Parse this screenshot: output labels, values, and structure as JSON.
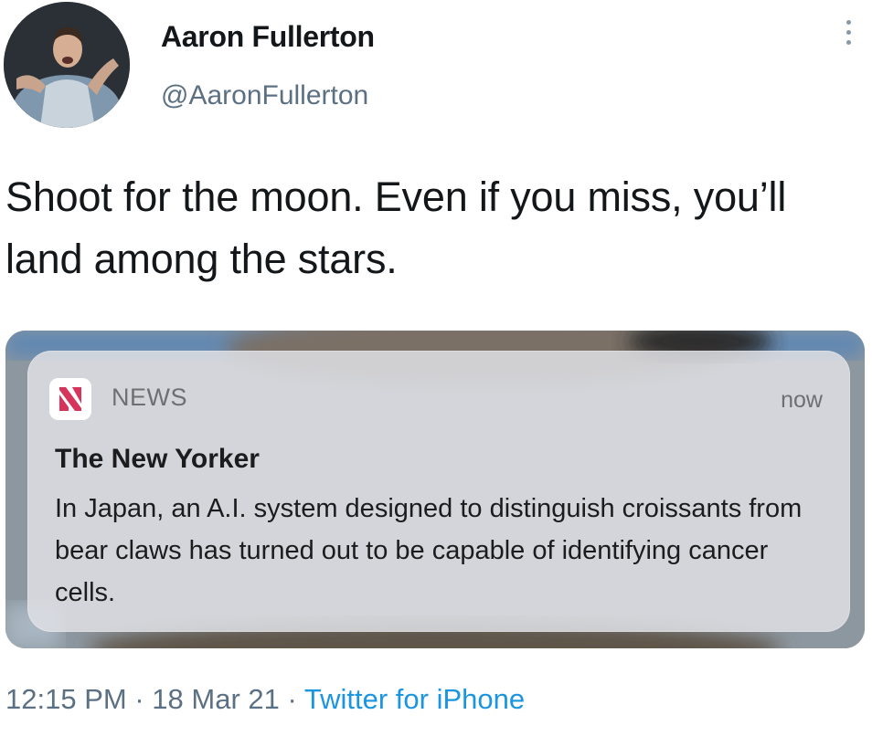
{
  "tweet": {
    "author": {
      "display_name": "Aaron Fullerton",
      "handle": "@AaronFullerton",
      "avatar_icon": "person-photo-avatar"
    },
    "more_icon": "more-vertical-icon",
    "text": "Shoot for the moon. Even if you miss, you’ll land among the stars.",
    "media": {
      "notification": {
        "app_icon": "apple-news-icon",
        "app_name": "NEWS",
        "time": "now",
        "title": "The New Yorker",
        "body": "In Japan, an A.I. system designed to distinguish croissants from bear claws has turned out to be capable of identifying cancer cells."
      }
    },
    "meta": {
      "time": "12:15 PM",
      "separator": "·",
      "date": "18 Mar 21",
      "source": "Twitter for iPhone"
    }
  },
  "colors": {
    "text_primary": "#14171a",
    "text_secondary": "#5b7083",
    "link": "#1b95e0",
    "news_red": "#d6345a"
  }
}
